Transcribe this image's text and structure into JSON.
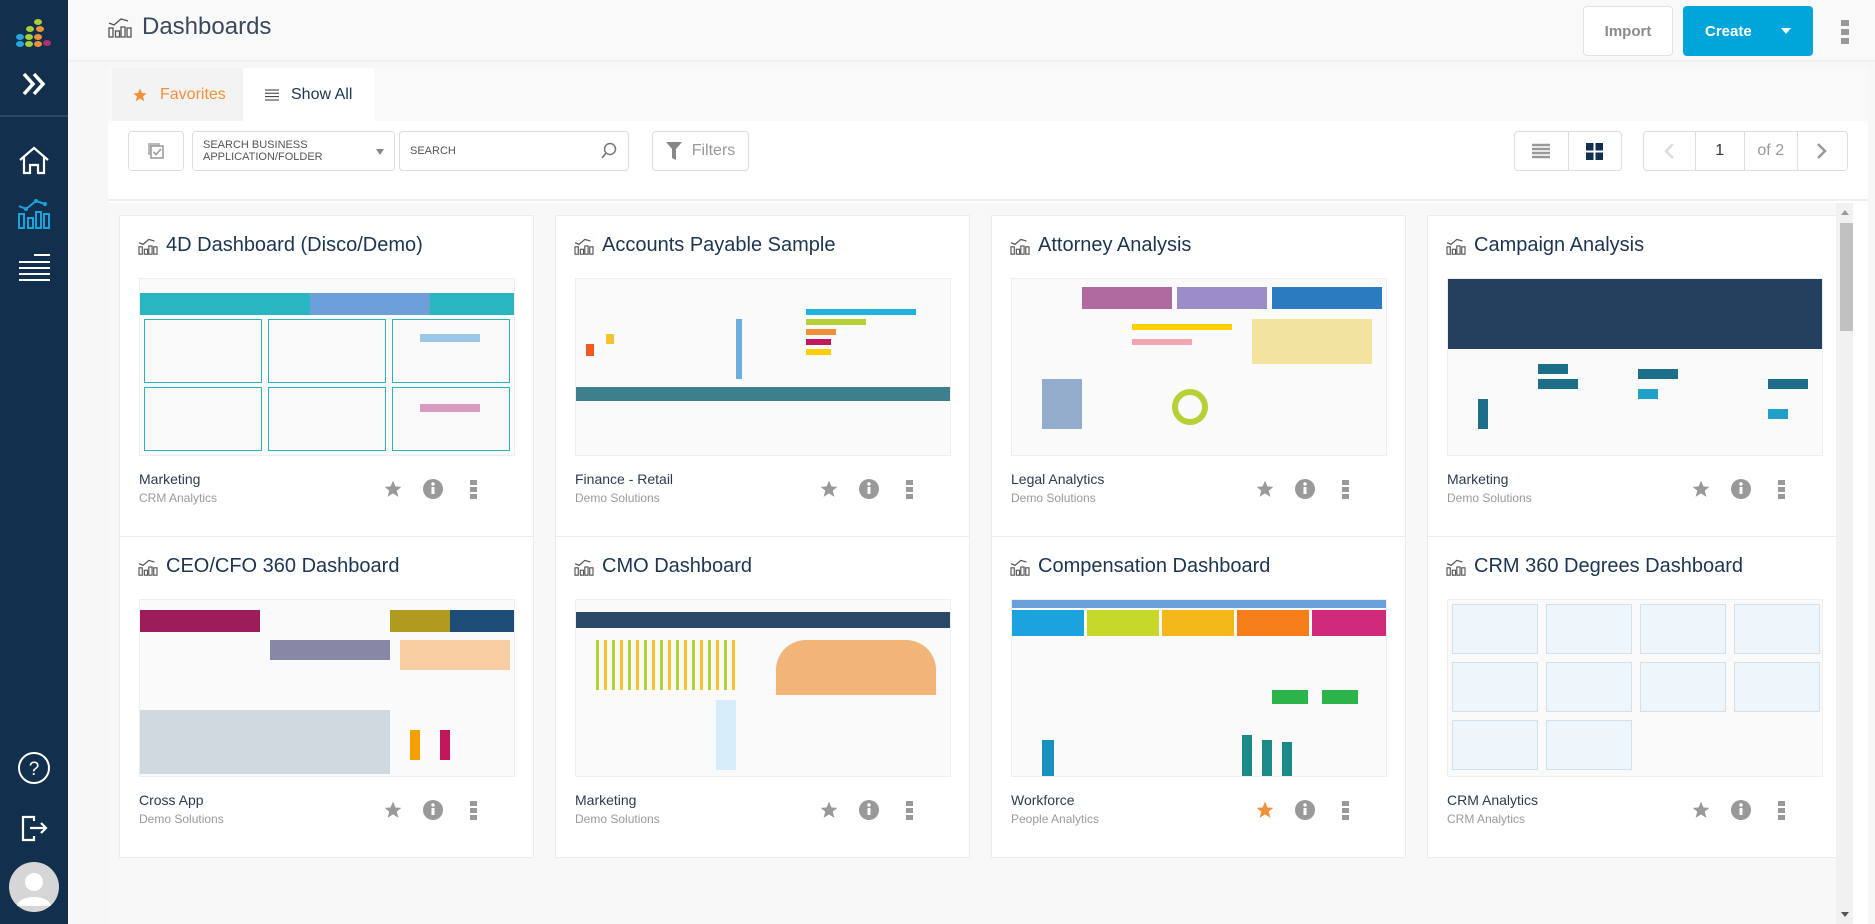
{
  "header": {
    "title": "Dashboards",
    "import_label": "Import",
    "create_label": "Create"
  },
  "sidebar": {
    "items": [
      {
        "name": "logo",
        "icon": "splash-logo-icon"
      },
      {
        "name": "expand",
        "icon": "double-chevron-right-icon"
      },
      {
        "name": "home",
        "icon": "home-icon"
      },
      {
        "name": "dashboards",
        "icon": "dashboard-chart-icon",
        "active": true
      },
      {
        "name": "menu",
        "icon": "list-icon"
      },
      {
        "name": "help",
        "icon": "help-icon"
      },
      {
        "name": "logout",
        "icon": "logout-icon"
      },
      {
        "name": "profile",
        "icon": "avatar-icon"
      }
    ]
  },
  "tabs": [
    {
      "label": "Favorites",
      "icon": "star-icon",
      "active": false
    },
    {
      "label": "Show All",
      "icon": "list-icon",
      "active": true
    }
  ],
  "toolbar": {
    "folder_placeholder": "SEARCH BUSINESS APPLICATION/FOLDER",
    "search_placeholder": "SEARCH",
    "filters_label": "Filters",
    "view_mode": "grid",
    "page": "1",
    "page_total": "of 2"
  },
  "cards": [
    {
      "title": "4D Dashboard (Disco/Demo)",
      "category": "Marketing",
      "subcategory": "CRM Analytics",
      "favorite": false
    },
    {
      "title": "Accounts Payable Sample",
      "category": "Finance - Retail",
      "subcategory": "Demo Solutions",
      "favorite": false
    },
    {
      "title": "Attorney Analysis",
      "category": "Legal Analytics",
      "subcategory": "Demo Solutions",
      "favorite": false
    },
    {
      "title": "Campaign Analysis",
      "category": "Marketing",
      "subcategory": "Demo Solutions",
      "favorite": false
    },
    {
      "title": "CEO/CFO 360 Dashboard",
      "category": "Cross App",
      "subcategory": "Demo Solutions",
      "favorite": false
    },
    {
      "title": "CMO Dashboard",
      "category": "Marketing",
      "subcategory": "Demo Solutions",
      "favorite": false
    },
    {
      "title": "Compensation Dashboard",
      "category": "Workforce",
      "subcategory": "People Analytics",
      "favorite": true
    },
    {
      "title": "CRM 360 Degrees Dashboard",
      "category": "CRM Analytics",
      "subcategory": "CRM Analytics",
      "favorite": false
    }
  ],
  "colors": {
    "sidebar_bg": "#12304d",
    "accent": "#00a6d9",
    "favorite": "#f0913a",
    "icon_gray": "#999999"
  }
}
